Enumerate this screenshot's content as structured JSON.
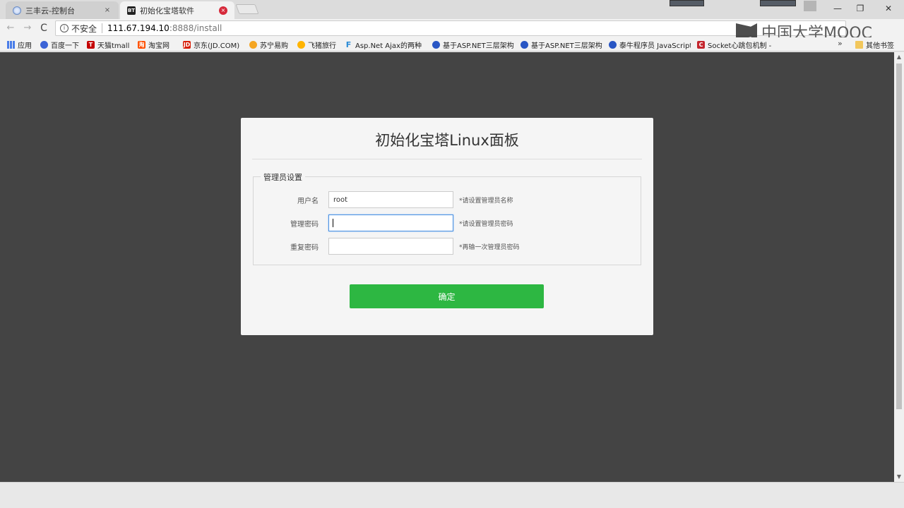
{
  "tabs": [
    {
      "title": "三丰云-控制台",
      "close": "×",
      "active": false
    },
    {
      "title": "初始化宝塔软件",
      "favicon": "BT",
      "close": "×",
      "active": true
    }
  ],
  "window_controls": {
    "minimize": "—",
    "maximize": "❐",
    "close": "✕"
  },
  "nav": {
    "back": "←",
    "forward": "→",
    "reload": "C"
  },
  "address": {
    "info": "i",
    "security_label": "不安全",
    "host": "111.67.194.10",
    "path": ":8888/install"
  },
  "watermark": {
    "text": "中国大学MOOC"
  },
  "bookmarks": [
    {
      "label": "应用",
      "icon": "apps-icon"
    },
    {
      "label": "百度一下",
      "icon": "baidu-paw-icon"
    },
    {
      "label": "天猫tmall",
      "icon": "tmall-icon",
      "glyph": "T"
    },
    {
      "label": "淘宝网",
      "icon": "taobao-icon",
      "glyph": "淘"
    },
    {
      "label": "京东(JD.COM)",
      "icon": "jd-icon",
      "glyph": "JD"
    },
    {
      "label": "苏宁易购",
      "icon": "suning-icon"
    },
    {
      "label": "飞猪旅行",
      "icon": "fliggy-icon"
    },
    {
      "label": "Asp.Net Ajax的两种",
      "icon": "f-icon",
      "glyph": "F"
    },
    {
      "label": "基于ASP.NET三层架构",
      "icon": "play-icon"
    },
    {
      "label": "基于ASP.NET三层架构",
      "icon": "play-icon"
    },
    {
      "label": "泰牛程序员 JavaScript",
      "icon": "play-icon"
    },
    {
      "label": "Socket心跳包机制 -",
      "icon": "socket-icon",
      "glyph": "C"
    },
    {
      "label": "其他书签",
      "icon": "folder-icon"
    }
  ],
  "bookmarks_more": "»",
  "panel": {
    "title": "初始化宝塔Linux面板",
    "legend": "管理员设置",
    "fields": [
      {
        "label": "用户名",
        "value": "root",
        "hint": "*请设置管理员名称"
      },
      {
        "label": "管理密码",
        "value": "",
        "hint": "*请设置管理员密码"
      },
      {
        "label": "重复密码",
        "value": "",
        "hint": "*再输一次管理员密码"
      }
    ],
    "confirm_label": "确定"
  },
  "scroll": {
    "up": "▲",
    "down": "▼"
  }
}
